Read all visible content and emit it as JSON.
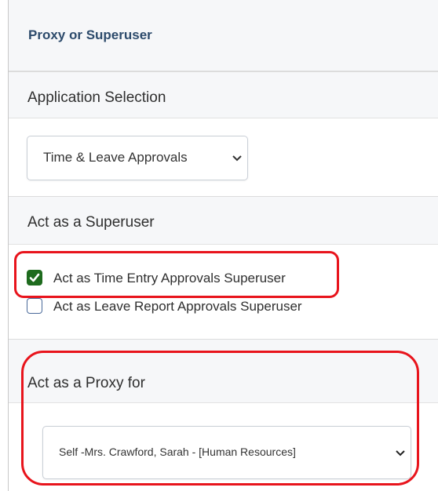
{
  "panel": {
    "title": "Proxy or Superuser"
  },
  "application_selection": {
    "heading": "Application Selection",
    "select_value": "Time & Leave Approvals"
  },
  "superuser": {
    "heading": "Act as a Superuser",
    "options": [
      {
        "label": "Act as Time Entry Approvals Superuser",
        "checked": true
      },
      {
        "label": "Act as Leave Report Approvals Superuser",
        "checked": false
      }
    ]
  },
  "proxy": {
    "heading": "Act as a Proxy for",
    "select_value": "Self -Mrs. Crawford, Sarah - [Human Resources]"
  },
  "colors": {
    "checkbox_checked": "#1e6b1e",
    "annotation_red": "#e8141c",
    "title_blue": "#2c4a6b"
  }
}
